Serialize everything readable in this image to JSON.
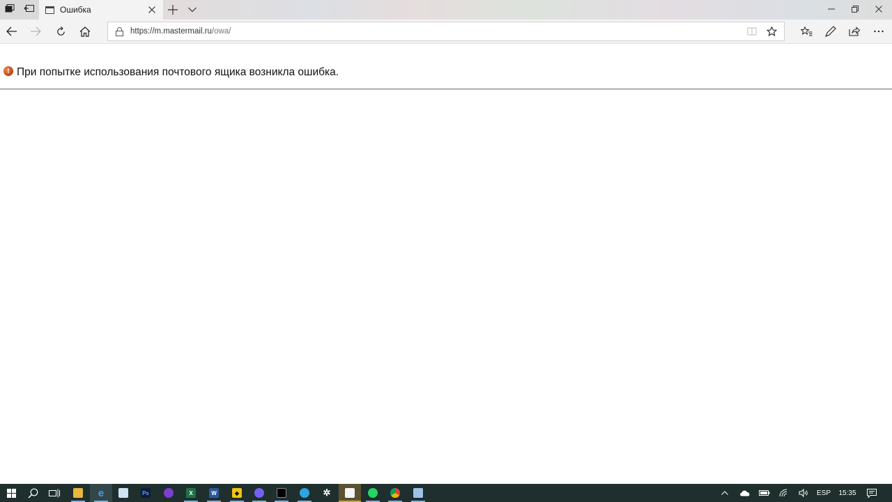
{
  "browser": {
    "tab_title": "Ошибка",
    "url_host": "https://m.mastermail.ru",
    "url_path": "/owa/"
  },
  "page": {
    "error_message": "При попытке использования почтового ящика возникла ошибка."
  },
  "icons": {
    "tab_actions": [
      "tabs-aside-icon",
      "restore-tabs-icon"
    ],
    "nav": [
      "back-icon",
      "forward-icon",
      "refresh-icon",
      "home-icon"
    ],
    "toolbar_right": [
      "favorites-icon",
      "notes-icon",
      "share-icon",
      "more-icon"
    ],
    "taskbar_apps": [
      "file-explorer-icon",
      "edge-icon",
      "store-icon",
      "photoshop-icon",
      "tor-icon",
      "excel-icon",
      "word-icon",
      "batman-icon",
      "viber-icon",
      "terminal-icon",
      "telegram-icon",
      "settings-icon",
      "calendar-icon",
      "whatsapp-icon",
      "chrome-icon",
      "notes-app-icon"
    ]
  },
  "taskbar": {
    "language": "ESP",
    "time": "15:35"
  },
  "colors": {
    "taskbar_bg": "#1f2f2e",
    "error_icon": "#c2410c",
    "active_underline": "#7fb2d9"
  }
}
